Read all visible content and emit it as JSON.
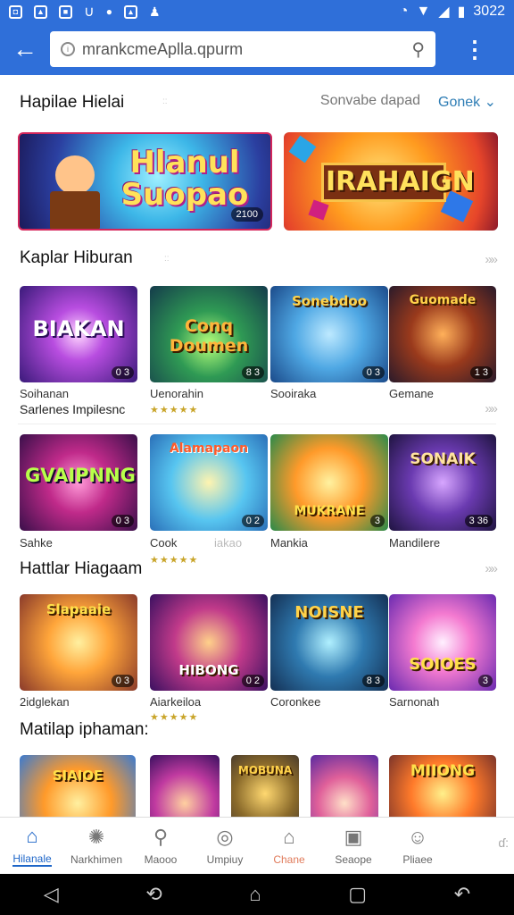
{
  "status": {
    "time": "3022"
  },
  "browser": {
    "url": "mrankcmeAplla.qpurm"
  },
  "top_links": {
    "a": "Sonvabe dapad",
    "b": "Gonek"
  },
  "banners": [
    {
      "text": "Hlanul Suopao",
      "badge": "2100"
    },
    {
      "text": "IRAHAIGN",
      "badge": ""
    }
  ],
  "sections": {
    "s1": {
      "title": "Kaplar Hiburan"
    },
    "s2": {
      "title": "Hattlar Hiagaam"
    },
    "s3": {
      "title": "Matilap iphaman:"
    }
  },
  "more_glyph": "»»",
  "row1": [
    {
      "art": "BIAKAN",
      "label": "Soihanan",
      "badge": "0 3"
    },
    {
      "art": "Conq Doumen",
      "label": "Uenorahin",
      "badge": "8 3"
    },
    {
      "art": "Sonebdoo",
      "label": "Sooiraka",
      "badge": "0 3"
    },
    {
      "art": "Guomade",
      "label": "Gemane",
      "badge": "1 3"
    }
  ],
  "row1_sub": "Sarlenes Impilesnc",
  "row2": [
    {
      "art": "GVAIPNNG",
      "label": "Sahke",
      "badge": "0 3"
    },
    {
      "art": "Alamapaon",
      "label": "Cook",
      "badge": "0 2"
    },
    {
      "art": "MUKRANE",
      "label": "Mankia",
      "badge": "3"
    },
    {
      "art": "SONAIK",
      "label": "Mandilere",
      "badge": "3 36"
    }
  ],
  "row2_extra": "iakao",
  "row3": [
    {
      "art": "Slapaaie",
      "label": "2idglekan",
      "badge": "0 3"
    },
    {
      "art": "HIBONG",
      "label": "Aiarkeiloa",
      "badge": "0 2"
    },
    {
      "art": "NOISNE",
      "label": "Coronkee",
      "badge": "8 3"
    },
    {
      "art": "SOIOES",
      "label": "Sarnonah",
      "badge": "3"
    }
  ],
  "row4": [
    {
      "art": "SIAIOE"
    },
    {
      "art": ""
    },
    {
      "art": "MOBUNA"
    },
    {
      "art": ""
    },
    {
      "art": "MIIONG"
    }
  ],
  "title_main": "Hapilae Hielai",
  "nav": [
    {
      "label": "Hilanale",
      "icon": "home-icon",
      "glyph": "⌂",
      "active": true
    },
    {
      "label": "Narkhimen",
      "icon": "compass-icon",
      "glyph": "✺"
    },
    {
      "label": "Maooo",
      "icon": "search-icon",
      "glyph": "⚲"
    },
    {
      "label": "Umpiuy",
      "icon": "disc-icon",
      "glyph": "◎"
    },
    {
      "label": "Chane",
      "icon": "store-icon",
      "glyph": "⌂"
    },
    {
      "label": "Seaope",
      "icon": "gamepad-icon",
      "glyph": "▣"
    },
    {
      "label": "Pliaee",
      "icon": "profile-icon",
      "glyph": "☺"
    }
  ],
  "nav_extra": "ɗ:"
}
